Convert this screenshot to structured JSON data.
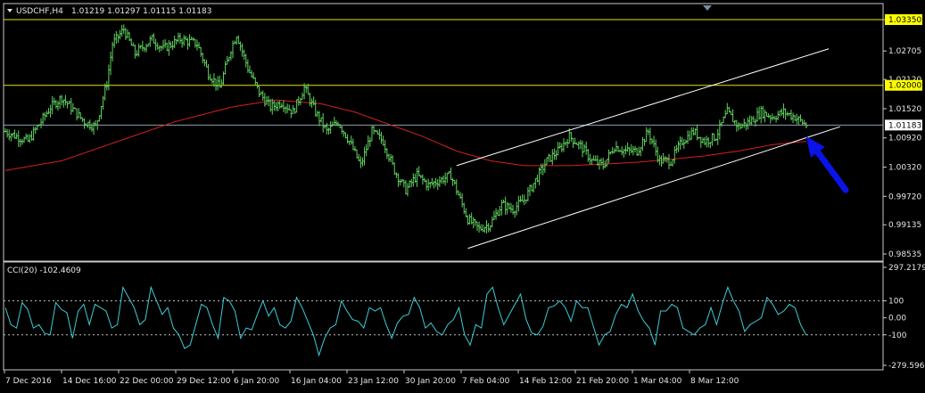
{
  "header": {
    "symbol_info": "USDCHF,H4",
    "ohlc": "1.01219 1.01297 1.01115 1.01183"
  },
  "indicator": {
    "label": "CCI(20) -102.4609"
  },
  "colors": {
    "background": "#000000",
    "candles": "#5fd25f",
    "moving_average": "#d42020",
    "channel": "#ffffff",
    "horizontal_levels": "#e6e600",
    "current_price_line": "#8aa0b4",
    "cci_line": "#3ccdd6",
    "cci_levels": "#c0c0c0",
    "current_price_tag": "#ffffff",
    "level_tag": "#ffff00",
    "arrow": "#0a14e6",
    "axis_text": "#e6e6e6"
  },
  "icons": {
    "symbol_menu": "triangle-down-icon",
    "arrow": "blue-arrow-icon"
  },
  "chart_data": [
    {
      "type": "candlestick",
      "title": "USDCHF,H4",
      "y_ticks": [
        "1.03350",
        "1.02705",
        "1.02120",
        "1.01520",
        "1.00920",
        "1.00320",
        "0.99720",
        "0.99135",
        "0.98535"
      ],
      "ylim": [
        0.98535,
        1.0335
      ],
      "x_ticks": [
        "7 Dec 2016",
        "14 Dec 16:00",
        "22 Dec 00:00",
        "29 Dec 12:00",
        "6 Jan 20:00",
        "16 Jan 04:00",
        "23 Jan 12:00",
        "30 Jan 20:00",
        "7 Feb 04:00",
        "14 Feb 12:00",
        "21 Feb 20:00",
        "1 Mar 04:00",
        "8 Mar 12:00"
      ],
      "horizontal_levels": [
        {
          "value": 1.0335,
          "label": "1.03350"
        },
        {
          "value": 1.02,
          "label": "1.02000"
        }
      ],
      "current_price": {
        "value": 1.01183,
        "label": "1.01183"
      },
      "close_path": [
        [
          0,
          1.0105
        ],
        [
          4,
          1.0085
        ],
        [
          8,
          1.0155
        ],
        [
          10,
          1.0175
        ],
        [
          14,
          1.0125
        ],
        [
          16,
          1.0115
        ],
        [
          18,
          1.0205
        ],
        [
          19,
          1.0285
        ],
        [
          21,
          1.0315
        ],
        [
          23,
          1.0265
        ],
        [
          26,
          1.0295
        ],
        [
          28,
          1.0275
        ],
        [
          31,
          1.0295
        ],
        [
          34,
          1.0285
        ],
        [
          36,
          1.0225
        ],
        [
          38,
          1.0195
        ],
        [
          40,
          1.0275
        ],
        [
          41,
          1.0305
        ],
        [
          43,
          1.0235
        ],
        [
          45,
          1.0185
        ],
        [
          47,
          1.0155
        ],
        [
          49,
          1.0165
        ],
        [
          51,
          1.0145
        ],
        [
          53,
          1.0195
        ],
        [
          55,
          1.0145
        ],
        [
          57,
          1.0105
        ],
        [
          59,
          1.0125
        ],
        [
          61,
          1.0085
        ],
        [
          63,
          1.0035
        ],
        [
          65,
          1.0105
        ],
        [
          67,
          1.0085
        ],
        [
          69,
          1.0025
        ],
        [
          71,
          0.9985
        ],
        [
          73,
          1.0015
        ],
        [
          75,
          0.9995
        ],
        [
          77,
          1.0005
        ],
        [
          79,
          1.0015
        ],
        [
          80,
          0.9985
        ],
        [
          82,
          0.9925
        ],
        [
          84,
          0.9905
        ],
        [
          86,
          0.9915
        ],
        [
          88,
          0.9955
        ],
        [
          90,
          0.9945
        ],
        [
          92,
          0.9965
        ],
        [
          94,
          1.0005
        ],
        [
          96,
          1.0045
        ],
        [
          98,
          1.0065
        ],
        [
          100,
          1.0095
        ],
        [
          102,
          1.0075
        ],
        [
          104,
          1.0045
        ],
        [
          106,
          1.0035
        ],
        [
          108,
          1.0075
        ],
        [
          110,
          1.0065
        ],
        [
          112,
          1.0065
        ],
        [
          114,
          1.0105
        ],
        [
          116,
          1.0045
        ],
        [
          118,
          1.0045
        ],
        [
          120,
          1.0085
        ],
        [
          122,
          1.0105
        ],
        [
          124,
          1.0085
        ],
        [
          126,
          1.0095
        ],
        [
          128,
          1.0145
        ],
        [
          130,
          1.0115
        ],
        [
          132,
          1.0125
        ],
        [
          134,
          1.0145
        ],
        [
          136,
          1.0135
        ],
        [
          138,
          1.0145
        ],
        [
          140,
          1.0135
        ],
        [
          142,
          1.0118
        ]
      ],
      "moving_average_path": [
        [
          0,
          1.0025
        ],
        [
          10,
          1.0045
        ],
        [
          20,
          1.0085
        ],
        [
          30,
          1.0125
        ],
        [
          40,
          1.0155
        ],
        [
          48,
          1.017
        ],
        [
          56,
          1.0162
        ],
        [
          62,
          1.0145
        ],
        [
          68,
          1.012
        ],
        [
          74,
          1.0095
        ],
        [
          80,
          1.0065
        ],
        [
          86,
          1.0045
        ],
        [
          92,
          1.0035
        ],
        [
          100,
          1.0035
        ],
        [
          106,
          1.0038
        ],
        [
          112,
          1.0042
        ],
        [
          118,
          1.0048
        ],
        [
          124,
          1.0055
        ],
        [
          130,
          1.0065
        ],
        [
          136,
          1.0078
        ],
        [
          142,
          1.0085
        ]
      ],
      "channel_lines": [
        {
          "from": [
            80,
            1.0035
          ],
          "to": [
            146,
            1.0275
          ]
        },
        {
          "from": [
            82,
            0.9865
          ],
          "to": [
            148,
            1.0115
          ]
        }
      ],
      "arrow": {
        "tip": [
          142,
          1.0095
        ],
        "tail": [
          149,
          0.9985
        ]
      }
    },
    {
      "type": "line",
      "title": "CCI(20) -102.4609",
      "y_ticks": [
        "297.2179",
        "100",
        "0.00",
        "-100",
        "-279.5963"
      ],
      "ylim": [
        -279.5963,
        297.2179
      ],
      "levels": [
        100,
        -100
      ],
      "x_range": [
        0,
        142
      ],
      "series": [
        {
          "values": [
            60,
            -40,
            -60,
            90,
            50,
            -60,
            -40,
            -90,
            -100,
            90,
            50,
            30,
            -120,
            40,
            80,
            -40,
            80,
            60,
            40,
            -60,
            -40,
            180,
            120,
            60,
            -40,
            -10,
            180,
            100,
            20,
            60,
            -60,
            -100,
            -180,
            -160,
            -40,
            80,
            60,
            -40,
            -120,
            120,
            100,
            40,
            -120,
            -60,
            -70,
            20,
            100,
            10,
            60,
            -40,
            -60,
            -20,
            120,
            60,
            -20,
            -100,
            -220,
            -120,
            -60,
            -40,
            100,
            40,
            -10,
            -20,
            -60,
            60,
            40,
            60,
            -40,
            -120,
            -30,
            10,
            20,
            120,
            60,
            -60,
            -30,
            -80,
            -100,
            -40,
            -10,
            60,
            -100,
            -160,
            -40,
            -60,
            140,
            180,
            60,
            -40,
            20,
            80,
            140,
            -10,
            -90,
            -100,
            -50,
            60,
            70,
            100,
            60,
            -20,
            100,
            60,
            60,
            -50,
            -160,
            -100,
            -80,
            20,
            80,
            60,
            140,
            40,
            -20,
            -60,
            -160,
            40,
            40,
            80,
            60,
            -60,
            -80,
            -100,
            -60,
            -40,
            60,
            -40,
            80,
            180,
            100,
            40,
            -80,
            -40,
            -20,
            0,
            120,
            80,
            20,
            40,
            80,
            60,
            -40,
            -102
          ]
        }
      ]
    }
  ]
}
